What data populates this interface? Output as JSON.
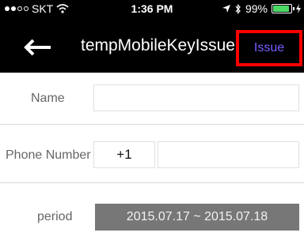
{
  "status_bar": {
    "carrier": "SKT",
    "time": "1:36 PM",
    "battery": "99%",
    "battery_level": 0.99
  },
  "nav": {
    "title": "tempMobileKeyIssue",
    "issue_label": "Issue"
  },
  "form": {
    "name_label": "Name",
    "name_value": "",
    "phone_label": "Phone Number",
    "country_code": "+1",
    "phone_value": "",
    "period_label": "period",
    "period_value": "2015.07.17 ~ 2015.07.18"
  },
  "colors": {
    "issue_text": "#7b5cff",
    "highlight_border": "#ff0000",
    "battery_fill": "#4cd964"
  },
  "icons": [
    "signal-dots-icon",
    "wifi-icon",
    "location-arrow-icon",
    "bluetooth-icon",
    "battery-icon",
    "charging-icon",
    "back-arrow-icon"
  ]
}
